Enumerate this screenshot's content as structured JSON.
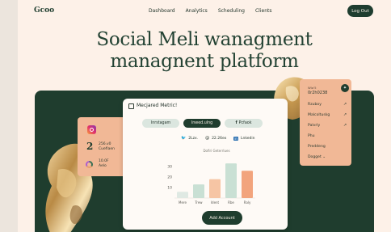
{
  "nav": {
    "logo": "Gcoo",
    "links": [
      "Dashboard",
      "Analytics",
      "Scheduling",
      "Clients"
    ],
    "logout": "Log Out"
  },
  "hero": {
    "line1": "Social Meli wanagment",
    "line2": "managnent platform"
  },
  "left_card": {
    "big_number": "2",
    "stat1_line1": "256.v0",
    "stat1_line2": "Cuefiaen",
    "stat2_line1": "10.0F",
    "stat2_line2": "Aelo"
  },
  "right_card": {
    "head1": "Wlo'5",
    "head2": "0r2h0238",
    "badge": "✦",
    "items": [
      "Rzuboy",
      "Malcoltuskg",
      "Palvrly",
      "Phu",
      "Preddeng",
      "Dogget"
    ]
  },
  "main_card": {
    "title": "Mecjared Metric!",
    "tabs": [
      "Inrstagam",
      "Inwed.ulng",
      "Pcfaok"
    ],
    "socials": [
      {
        "icon": "twitter-icon",
        "label": "2Lzx."
      },
      {
        "icon": "threads-icon",
        "label": "22.26ex"
      },
      {
        "icon": "linkedin-icon",
        "label": "Lnkedin"
      }
    ],
    "add_button": "Add Account"
  },
  "chart_data": {
    "type": "bar",
    "title": "Dofiri Geterrlues",
    "categories": [
      "Mere",
      "Trew",
      "Ident",
      "Rbe",
      "Raly"
    ],
    "values": [
      6,
      13,
      18,
      33,
      26
    ],
    "colors": [
      "#dfe9e3",
      "#c9e0d4",
      "#f6c5a4",
      "#c9e0d4",
      "#f2a47d"
    ],
    "yticks": [
      10,
      20,
      30
    ],
    "ylim": [
      0,
      40
    ]
  },
  "colors": {
    "dark_green": "#1f3d2e",
    "peach": "#f1b896",
    "cream": "#fdf1e8"
  }
}
